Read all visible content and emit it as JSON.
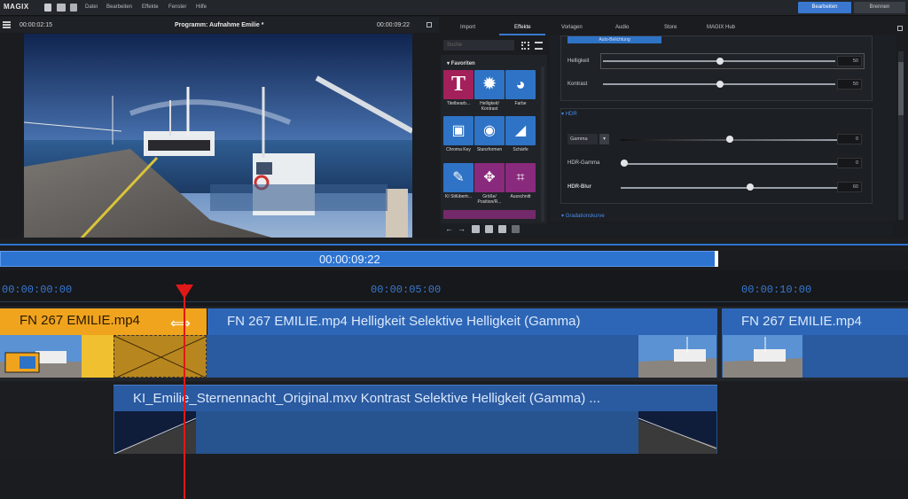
{
  "menubar": {
    "logo": "MAGIX",
    "items": [
      "Datei",
      "Bearbeiten",
      "Effekte",
      "Fenster",
      "Hilfe"
    ],
    "edit_button": "Bearbeiten",
    "burn_button": "Brennen"
  },
  "preview": {
    "timecode_left": "00:00:02:15",
    "title": "Programm: Aufnahme Emilie *",
    "timecode_right": "00:00:09:22"
  },
  "tabs": [
    "Import",
    "Effekte",
    "Vorlagen",
    "Audio",
    "Store",
    "MAGIX Hub"
  ],
  "active_tab": "Effekte",
  "search": {
    "placeholder": "Suche"
  },
  "effects": {
    "group": "Favoriten",
    "items": [
      {
        "label": "Titelbearb...",
        "icon": "title-T-icon",
        "color": "#a3205a"
      },
      {
        "label": "Helligkeit/ Kontrast",
        "icon": "brightness-sun-icon",
        "color": "#2e73c6"
      },
      {
        "label": "Farbe",
        "icon": "palette-icon",
        "color": "#2e73c6"
      },
      {
        "label": "Chroma Key",
        "icon": "chroma-key-icon",
        "color": "#2e73c6"
      },
      {
        "label": "Stanzformen",
        "icon": "eye-icon",
        "color": "#2e73c6"
      },
      {
        "label": "Schärfe",
        "icon": "sharpen-icon",
        "color": "#2e73c6"
      },
      {
        "label": "KI Stilübertr...",
        "icon": "style-brush-icon",
        "color": "#2e73c6"
      },
      {
        "label": "Größe/ Position/R...",
        "icon": "move-icon",
        "color": "#8a2a7c"
      },
      {
        "label": "Ausschnitt",
        "icon": "crop-icon",
        "color": "#8a2a7c"
      }
    ]
  },
  "settings": {
    "auto_button": "Auto-Belichtung",
    "helligkeit": {
      "label": "Helligkeit",
      "value": "50"
    },
    "kontrast": {
      "label": "Kontrast",
      "value": "50"
    },
    "hdr_title": "HDR",
    "gamma": {
      "select": "Gamma",
      "value": "0"
    },
    "hdr_gamma": {
      "label": "HDR-Gamma",
      "value": "0"
    },
    "hdr_blur": {
      "label": "HDR-Blur",
      "value": "60"
    },
    "curve_title": "Gradationskurve"
  },
  "timeline": {
    "position": "00:00:09:22",
    "ruler": [
      "00:00:00:00",
      "00:00:05:00",
      "00:00:10:00"
    ],
    "track1": {
      "clip1": "FN 267 EMILIE.mp4",
      "clip2": "FN 267 EMILIE.mp4  Helligkeit  Selektive Helligkeit (Gamma)",
      "clip3": "FN 267 EMILIE.mp4"
    },
    "track2": {
      "clip": "KI_Emilie_Sternennacht_Original.mxv  Kontrast  Selektive Helligkeit (Gamma) ..."
    }
  },
  "colors": {
    "accent": "#3a78d0",
    "playhead": "#e01818",
    "clip_selected": "#f0a41e",
    "clip": "#2a5fa8"
  }
}
